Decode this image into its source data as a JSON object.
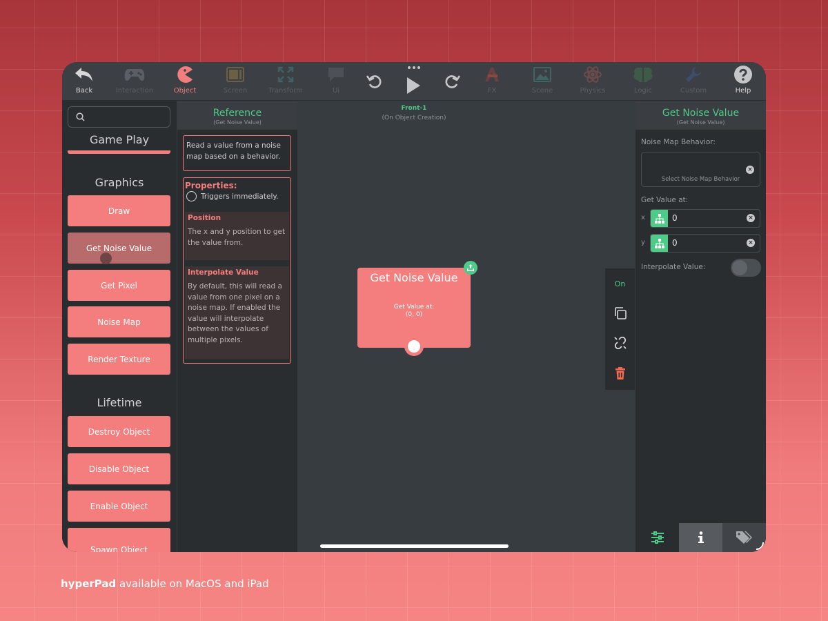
{
  "toolbar": {
    "items": [
      {
        "label": "Back"
      },
      {
        "label": "Interaction"
      },
      {
        "label": "Object"
      },
      {
        "label": "Screen"
      },
      {
        "label": "Transform"
      },
      {
        "label": "Ui"
      },
      {
        "label": "FX"
      },
      {
        "label": "Scene"
      },
      {
        "label": "Physics"
      },
      {
        "label": "Logic"
      },
      {
        "label": "Custom"
      },
      {
        "label": "Help"
      }
    ],
    "active": "Object"
  },
  "sidebar": {
    "search_placeholder": "",
    "sections": [
      {
        "title": "Game Play",
        "items": []
      },
      {
        "title": "Graphics",
        "items": [
          "Draw",
          "Get Noise Value",
          "Get Pixel",
          "Noise Map",
          "Render Texture"
        ]
      },
      {
        "title": "Lifetime",
        "items": [
          "Destroy Object",
          "Disable Object",
          "Enable Object",
          "Spawn Object"
        ]
      }
    ],
    "selected": "Get Noise Value"
  },
  "reference": {
    "title": "Reference",
    "subtitle": "(Get Noise Value)",
    "description": "Read a value from a noise map based on a behavior.",
    "properties_title": "Properties:",
    "trigger_text": "Triggers immediately.",
    "props": [
      {
        "name": "Position",
        "text": "The x and y position to get the value from."
      },
      {
        "name": "Interpolate Value",
        "text": "By default, this will read a value from one pixel on a noise map. If enabled the value will interpolate between the values of multiple pixels."
      }
    ]
  },
  "canvas": {
    "title": "Front-1",
    "subtitle": "(On Object Creation)",
    "node": {
      "title": "Get Noise Value",
      "line1": "Get Value at:",
      "line2": "(0, 0)"
    },
    "ctx_on": "On"
  },
  "inspector": {
    "title": "Get Noise Value",
    "subtitle": "(Get Noise Value)",
    "behavior_label": "Noise Map Behavior:",
    "behavior_placeholder": "Select Noise Map Behavior",
    "get_value_label": "Get Value at:",
    "x_label": "x",
    "x_value": "0",
    "y_label": "y",
    "y_value": "0",
    "interpolate_label": "Interpolate Value:",
    "interpolate_on": false
  },
  "footer": {
    "brand": "hyperPad",
    "text": " available on MacOS and iPad"
  },
  "colors": {
    "accent_pink": "#f47e7d",
    "accent_green": "#4ecb88",
    "panel_dark": "#2a2d30"
  }
}
